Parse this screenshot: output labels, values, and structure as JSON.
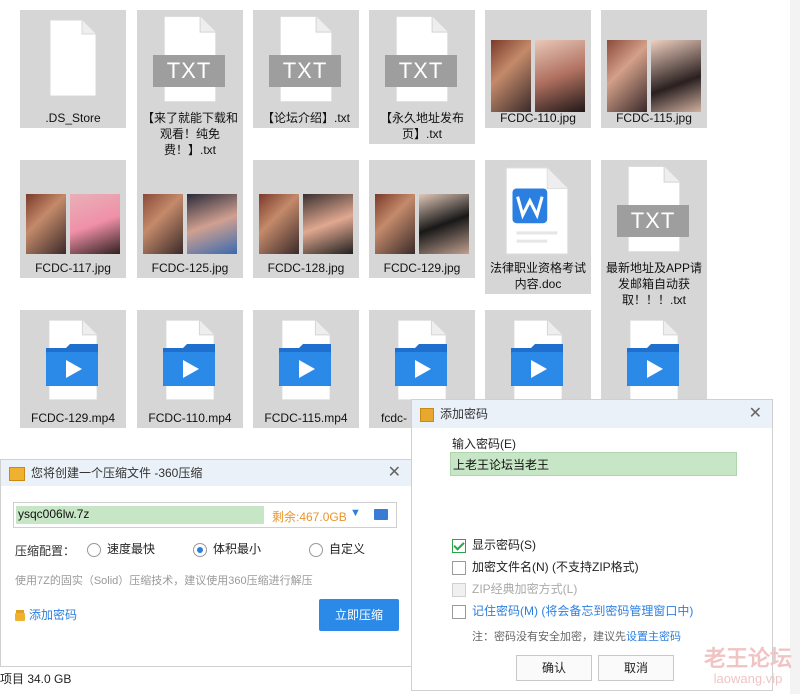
{
  "files": [
    {
      "name": ".DS_Store",
      "type": "blank"
    },
    {
      "name": "【来了就能下载和观看！纯免费！】.txt",
      "type": "txt"
    },
    {
      "name": "【论坛介绍】.txt",
      "type": "txt"
    },
    {
      "name": "【永久地址发布页】.txt",
      "type": "txt"
    },
    {
      "name": "FCDC-110.jpg",
      "type": "jpg"
    },
    {
      "name": "FCDC-115.jpg",
      "type": "jpg"
    },
    {
      "name": "FCDC-117.jpg",
      "type": "jpg"
    },
    {
      "name": "FCDC-125.jpg",
      "type": "jpg"
    },
    {
      "name": "FCDC-128.jpg",
      "type": "jpg"
    },
    {
      "name": "FCDC-129.jpg",
      "type": "jpg"
    },
    {
      "name": "法律职业资格考试内容.doc",
      "type": "doc"
    },
    {
      "name": "最新地址及APP请发邮箱自动获取！！！.txt",
      "type": "txt"
    },
    {
      "name": "FCDC-129.mp4",
      "type": "mp4"
    },
    {
      "name": "FCDC-110.mp4",
      "type": "mp4"
    },
    {
      "name": "FCDC-115.mp4",
      "type": "mp4"
    },
    {
      "name": "fcdc-",
      "type": "mp4"
    },
    {
      "name": "",
      "type": "mp4"
    },
    {
      "name": "",
      "type": "mp4"
    }
  ],
  "txt_icon_label": "TXT",
  "status": {
    "text": "项目  34.0 GB"
  },
  "compress": {
    "title": "您将创建一个压缩文件 -360压缩",
    "filename": "ysqc006lw.7z",
    "remaining": "剩余:467.0GB",
    "config_label": "压缩配置：",
    "options": [
      "速度最快",
      "体积最小",
      "自定义"
    ],
    "selected_option": "体积最小",
    "hint": "使用7Z的固实（Solid）压缩技术，建议使用360压缩进行解压",
    "add_password": "添加密码",
    "compress_button": "立即压缩"
  },
  "password": {
    "title": "添加密码",
    "input_label": "输入密码(E)",
    "input_value": "上老王论坛当老王",
    "show_password": "显示密码(S)",
    "show_password_checked": true,
    "encrypt_names": "加密文件名(N) (不支持ZIP格式)",
    "zip_classic": "ZIP经典加密方式(L)",
    "remember": "记住密码(M) (将会备忘到密码管理窗口中)",
    "note_prefix": "注：密码没有安全加密，建议先",
    "note_link": "设置主密码",
    "ok": "确认",
    "cancel": "取消"
  },
  "watermark": {
    "main": "老王论坛",
    "sub": "laowang.vip"
  },
  "colors": {
    "accent": "#2b7fe0",
    "input_green": "#c7e6c5",
    "warning_orange": "#e8952a",
    "panel_title": "#eaf1f8",
    "tile_bg": "#d6d6d6"
  }
}
